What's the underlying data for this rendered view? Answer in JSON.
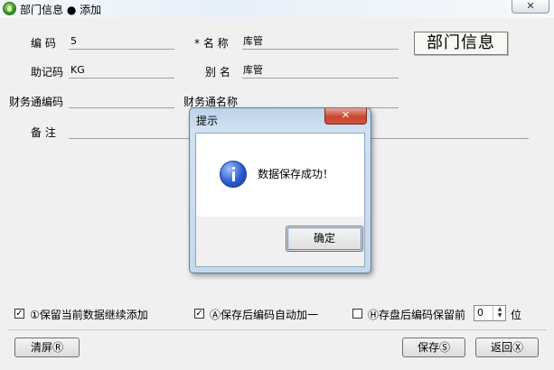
{
  "window": {
    "title": "部门信息 ● 添加",
    "close": "✕"
  },
  "form": {
    "code": {
      "label": "编  码",
      "value": "5"
    },
    "name": {
      "label": "* 名  称",
      "value": "库管"
    },
    "mnemonic": {
      "label": "助记码",
      "value": "KG"
    },
    "alias": {
      "label": "别  名",
      "value": "库管"
    },
    "fin_code": {
      "label": "财务通编码",
      "value": ""
    },
    "fin_name": {
      "label": "财务通名称",
      "value": ""
    },
    "remark": {
      "label": "备  注",
      "value": ""
    },
    "image_text": "部门信息"
  },
  "dialog": {
    "title": "提示",
    "close": "✕",
    "message": "数据保存成功！",
    "ok": "确定"
  },
  "options": {
    "keep_data": {
      "label": "①保留当前数据继续添加",
      "checked": true
    },
    "auto_increment": {
      "label": "Ⓐ保存后编码自动加一",
      "checked": true
    },
    "keep_prefix": {
      "label": "Ⓗ存盘后编码保留前",
      "checked": false,
      "value": "0",
      "unit": "位"
    }
  },
  "buttons": {
    "clear": "清屏Ⓡ",
    "save": "保存Ⓢ",
    "back": "返回Ⓧ"
  }
}
